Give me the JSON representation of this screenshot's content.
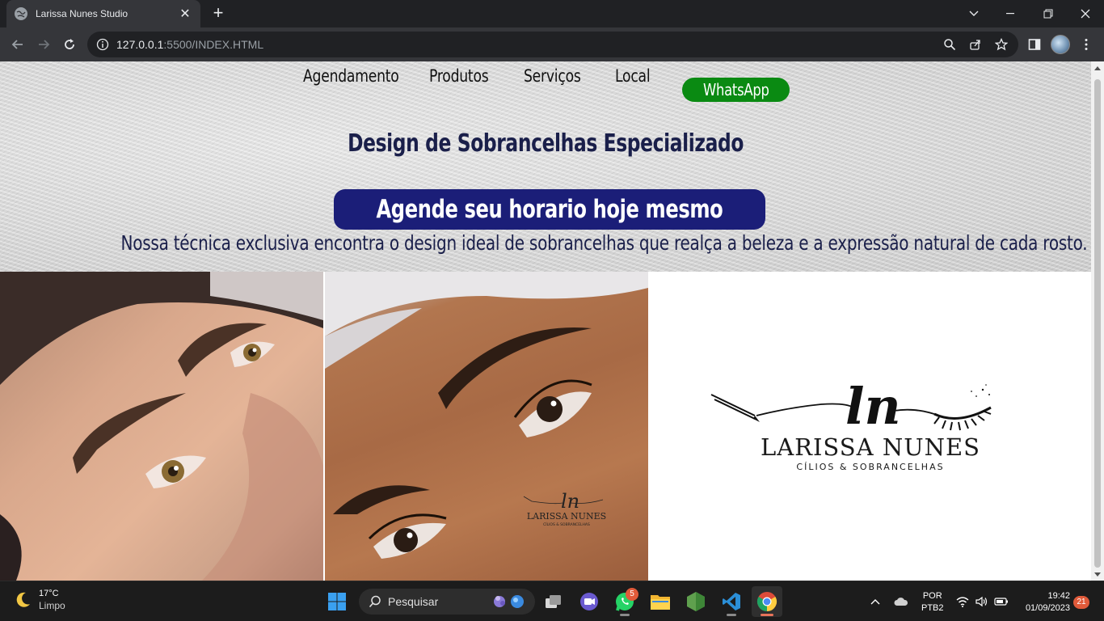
{
  "browser": {
    "tab_title": "Larissa Nunes Studio",
    "close_tab": "✕",
    "new_tab": "+",
    "url_host": "127.0.0.1",
    "url_path": ":5500/INDEX.HTML"
  },
  "nav": {
    "items": [
      "Agendamento",
      "Produtos",
      "Serviços",
      "Local"
    ],
    "whatsapp_label": "WhatsApp"
  },
  "hero": {
    "headline": "Design de Sobrancelhas Especializado",
    "cta": "Agende seu horario hoje mesmo",
    "tagline": "Nossa técnica exclusiva encontra o design ideal de sobrancelhas que realça a beleza e a expressão natural de cada rosto."
  },
  "logo": {
    "monogram": "ln",
    "name": "LARISSA NUNES",
    "subtitle": "CÍLIOS & SOBRANCELHAS"
  },
  "colors": {
    "nav_text": "#111111",
    "whatsapp_green": "#0a8a12",
    "cta_navy": "#1b1e78",
    "heading_navy": "#1a1f4a"
  },
  "taskbar": {
    "weather_temp": "17°C",
    "weather_cond": "Limpo",
    "search_placeholder": "Pesquisar",
    "whatsapp_badge": "5",
    "lang_top": "POR",
    "lang_bottom": "PTB2",
    "time": "19:42",
    "date": "01/09/2023",
    "notifications": "21"
  }
}
